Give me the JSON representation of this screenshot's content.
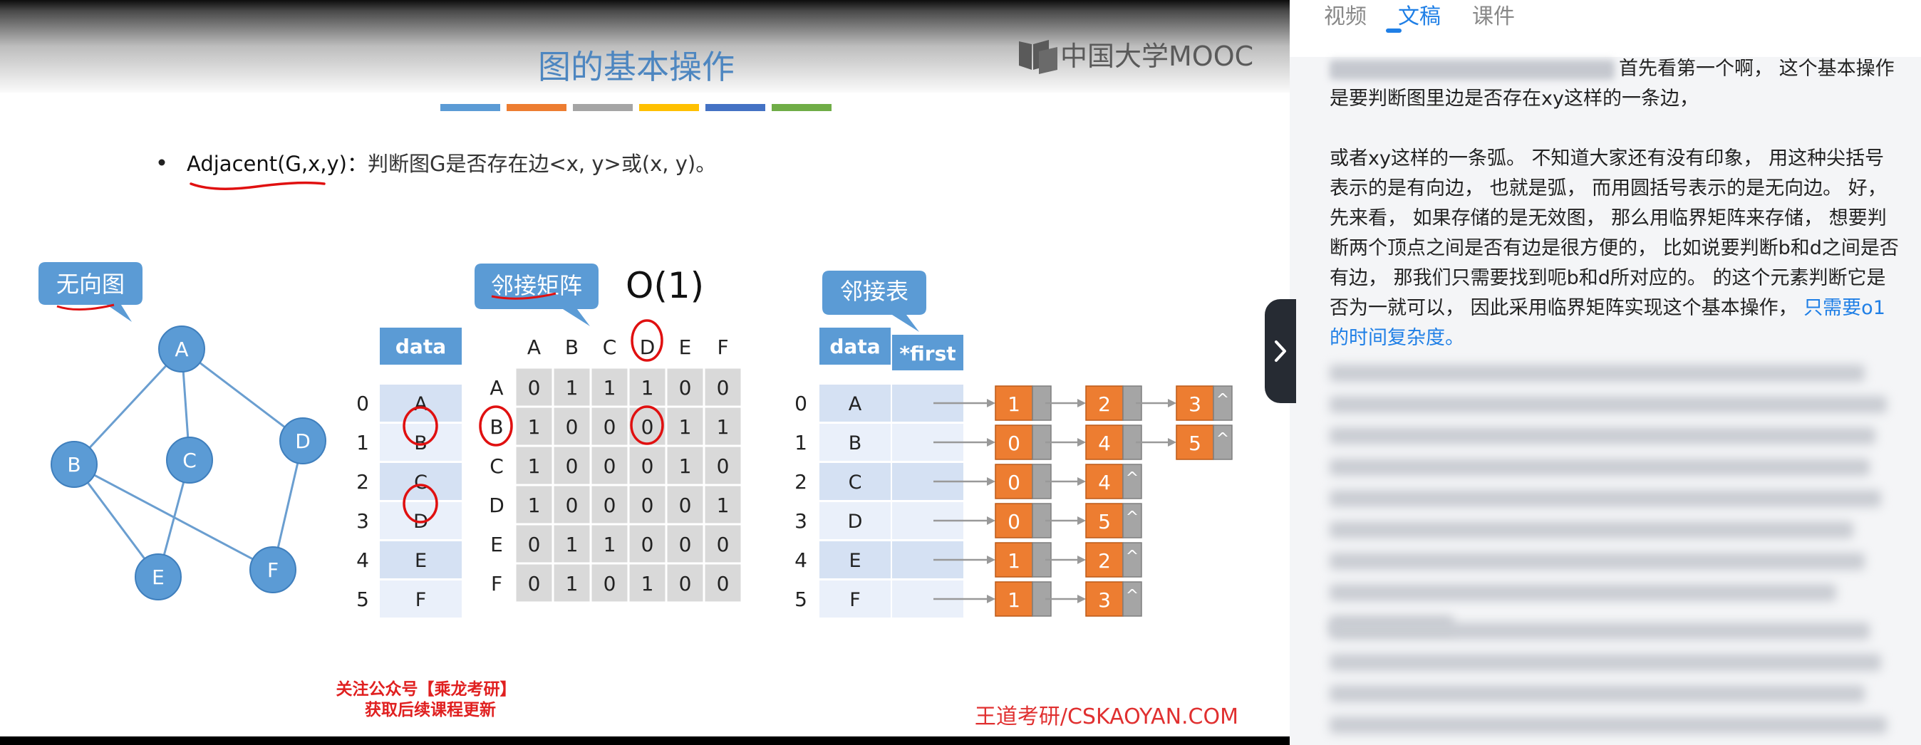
{
  "slide": {
    "title": "图的基本操作",
    "logo_text": "中国大学MOOC",
    "bullet": {
      "func": "Adjacent(G,x,y)",
      "colon": "：",
      "desc": "判断图G是否存在边<x, y>或(x, y)。"
    },
    "label_undirected": "无向图",
    "label_matrix": "邻接矩阵",
    "complexity": "O(1)",
    "label_list": "邻接表",
    "footer_promo_line1": "关注公众号【乘龙考研】",
    "footer_promo_line2": "获取后续课程更新",
    "watermark": "王道考研/CSKAOYAN.COM",
    "color_bars": [
      "#5b9bd5",
      "#ed7d31",
      "#a5a5a5",
      "#ffc000",
      "#4472c4",
      "#70ad47"
    ],
    "graph": {
      "vertices": [
        "A",
        "B",
        "C",
        "D",
        "E",
        "F"
      ],
      "edges": [
        [
          "A",
          "B"
        ],
        [
          "A",
          "C"
        ],
        [
          "A",
          "D"
        ],
        [
          "B",
          "E"
        ],
        [
          "B",
          "F"
        ],
        [
          "C",
          "E"
        ],
        [
          "D",
          "F"
        ]
      ]
    },
    "data_header": "data",
    "first_header": "*first",
    "indices": [
      "0",
      "1",
      "2",
      "3",
      "4",
      "5"
    ],
    "data_col": [
      "A",
      "B",
      "C",
      "D",
      "E",
      "F"
    ],
    "matrix_cols": [
      "A",
      "B",
      "C",
      "D",
      "E",
      "F"
    ],
    "matrix_rows": [
      "A",
      "B",
      "C",
      "D",
      "E",
      "F"
    ],
    "matrix": [
      [
        "0",
        "1",
        "1",
        "1",
        "0",
        "0"
      ],
      [
        "1",
        "0",
        "0",
        "0",
        "1",
        "1"
      ],
      [
        "1",
        "0",
        "0",
        "0",
        "1",
        "0"
      ],
      [
        "1",
        "0",
        "0",
        "0",
        "0",
        "1"
      ],
      [
        "0",
        "1",
        "1",
        "0",
        "0",
        "0"
      ],
      [
        "0",
        "1",
        "0",
        "1",
        "0",
        "0"
      ]
    ],
    "adj_lists": [
      [
        "1",
        "2",
        "3"
      ],
      [
        "0",
        "4",
        "5"
      ],
      [
        "0",
        "4"
      ],
      [
        "0",
        "5"
      ],
      [
        "1",
        "2"
      ],
      [
        "1",
        "3"
      ]
    ],
    "null_symbol": "^"
  },
  "panel": {
    "tabs": [
      "视频",
      "文稿",
      "课件"
    ],
    "active_tab": "文稿",
    "p1": "首先看第一个啊， 这个基本操作是要判断图里边是否存在xy这样的一条边，",
    "p2": "或者xy这样的一条弧。 不知道大家还有没有印象， 用这种尖括号表示的是有向边， 也就是弧， 而用圆括号表示的是无向边。 好， 先来看， 如果存储的是无效图， 那么用临界矩阵来存储， 想要判断两个顶点之间是否有边是很方便的， 比如说要判断b和d之间是否有边， 那我们只需要找到呃b和d所对应的。 的这个元素判断它是否为一就可以， 因此采用临界矩阵实现这个基本操作，",
    "p2_highlight": "只需要o1的时间复杂度。",
    "accent": "#1f7fe6"
  }
}
